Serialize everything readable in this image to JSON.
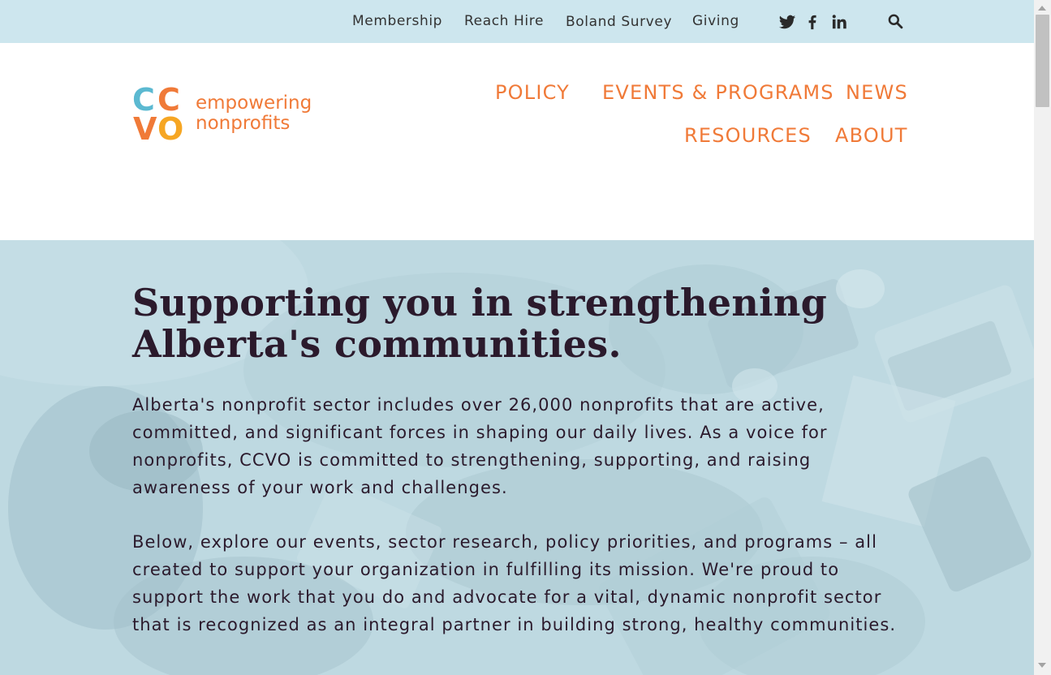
{
  "topbar": {
    "links": [
      "Membership",
      "Reach Hire",
      "Boland Survey",
      "Giving"
    ],
    "social_icons": [
      "twitter-icon",
      "facebook-icon",
      "linkedin-icon"
    ],
    "search_icon": "search-icon",
    "background": "#cde6ee",
    "text_color": "#333333"
  },
  "logo": {
    "letters": [
      "C",
      "C",
      "V",
      "O"
    ],
    "tagline_line1": "empowering",
    "tagline_line2": "nonprofits",
    "letter_colors": [
      "#5bb9d1",
      "#f07a38",
      "#f07a38",
      "#f6a623"
    ]
  },
  "main_nav": {
    "items": [
      "POLICY",
      "EVENTS & PROGRAMS",
      "NEWS",
      "RESOURCES",
      "ABOUT"
    ],
    "color": "#f07a38"
  },
  "hero": {
    "title_line1": "Supporting you in strengthening",
    "title_line2": "Alberta's communities.",
    "para1_lines": [
      "Alberta's nonprofit sector includes over 26,000 nonprofits that are active,",
      "committed, and significant forces in shaping our daily lives. As a voice for",
      "nonprofits, CCVO is committed to strengthening, supporting, and raising",
      "awareness of your work and challenges."
    ],
    "para2_lines": [
      "Below, explore our events, sector research, policy priorities, and programs – all",
      "created to support your organization in fulfilling its mission. We're proud to",
      "support the work that you do and advocate for a vital, dynamic nonprofit sector",
      "that is recognized as an integral partner in building strong, healthy communities."
    ],
    "text_color": "#2b1a2c",
    "background": "#bcd7df"
  }
}
